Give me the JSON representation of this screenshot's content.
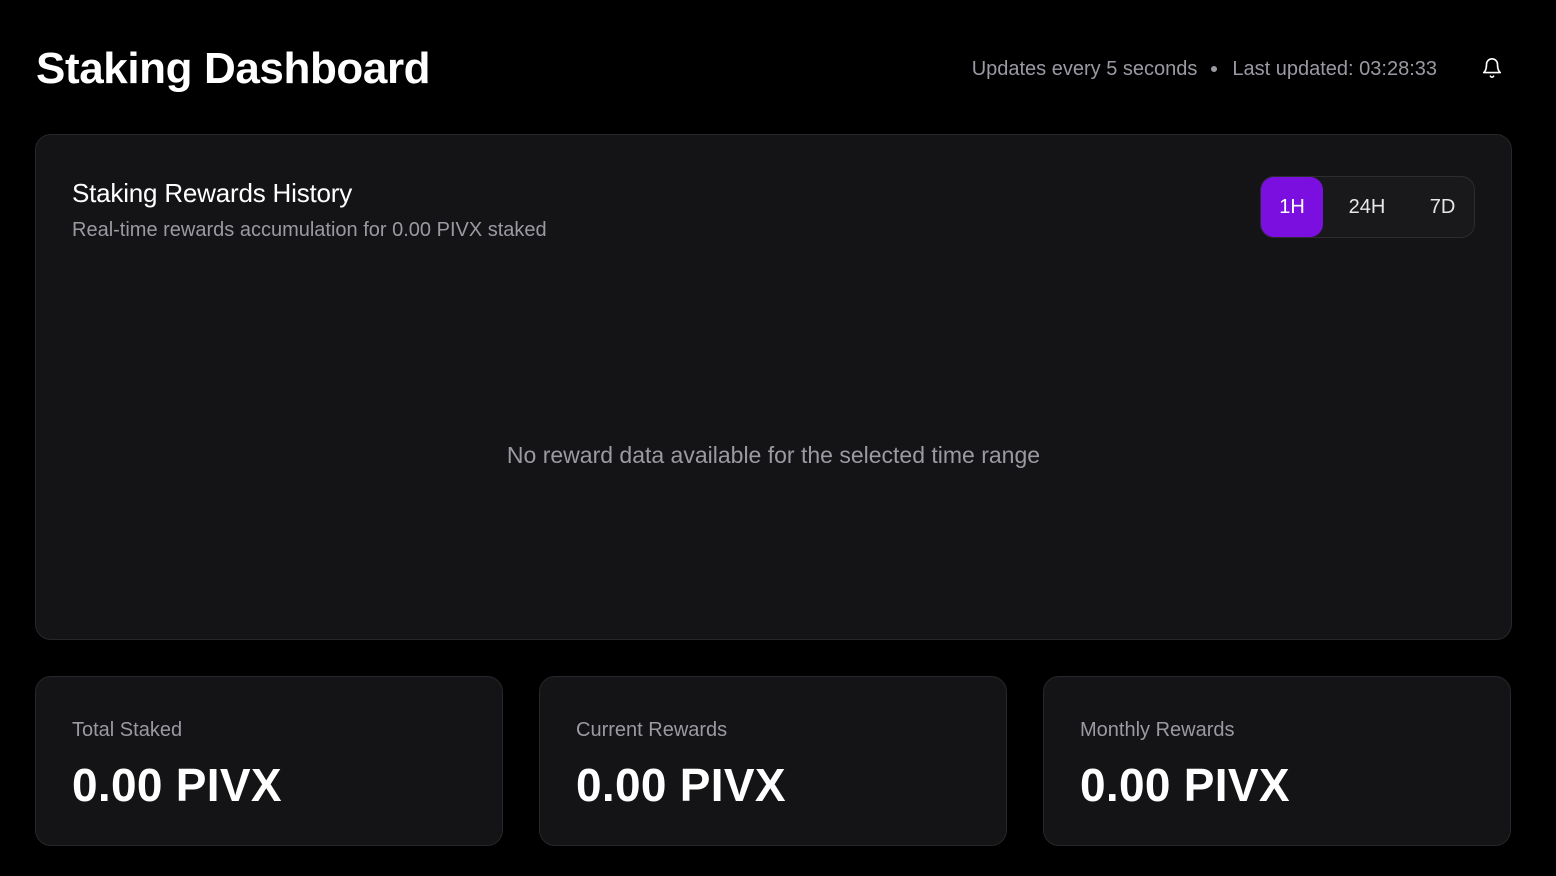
{
  "header": {
    "title": "Staking Dashboard",
    "update_interval": "Updates every 5 seconds",
    "last_updated": "Last updated: 03:28:33",
    "notification_icon": "bell-icon"
  },
  "history": {
    "title": "Staking Rewards History",
    "subtitle": "Real-time rewards accumulation for 0.00 PIVX staked",
    "ranges": [
      "1H",
      "24H",
      "7D"
    ],
    "selected_range": "1H",
    "empty_message": "No reward data available for the selected time range"
  },
  "stats": [
    {
      "label": "Total Staked",
      "value": "0.00 PIVX"
    },
    {
      "label": "Current Rewards",
      "value": "0.00 PIVX"
    },
    {
      "label": "Monthly Rewards",
      "value": "0.00 PIVX"
    }
  ],
  "colors": {
    "accent": "#7b0fe0",
    "background": "#000000",
    "card": "#141416",
    "muted_text": "#9a9aa2"
  }
}
